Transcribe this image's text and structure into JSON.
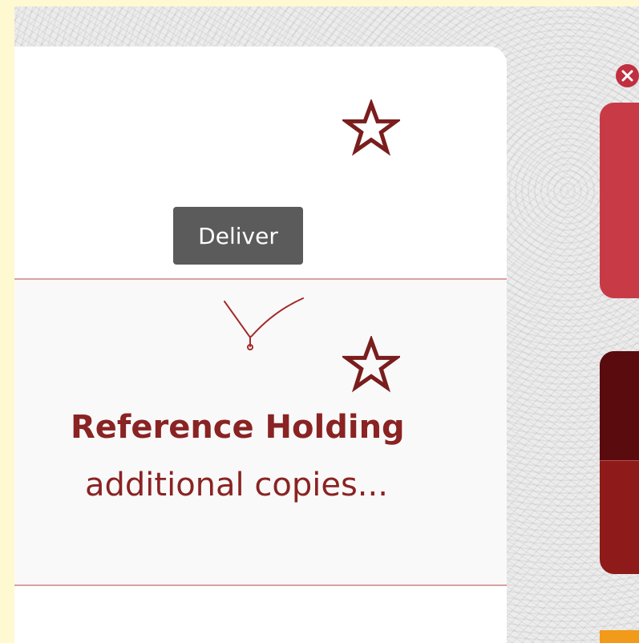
{
  "tooltip": {
    "text": "Deliver"
  },
  "holding": {
    "title": "Reference Holding",
    "subtitle": "additional copies..."
  },
  "colors": {
    "page_bg": "#fff9d2",
    "accent": "#8a2323",
    "star_outline": "#7a1d1d",
    "tile_red": "#c83b46",
    "tile_dark": "#5a0b0d",
    "tile_mid": "#8f1a1a",
    "divider": "#d9a0a0",
    "tooltip_bg": "#5b5b5b"
  },
  "icons": {
    "favorite_top": "star-outline-icon",
    "favorite_mid": "star-outline-icon",
    "deliver": "checkmark-icon",
    "close": "close-icon"
  }
}
